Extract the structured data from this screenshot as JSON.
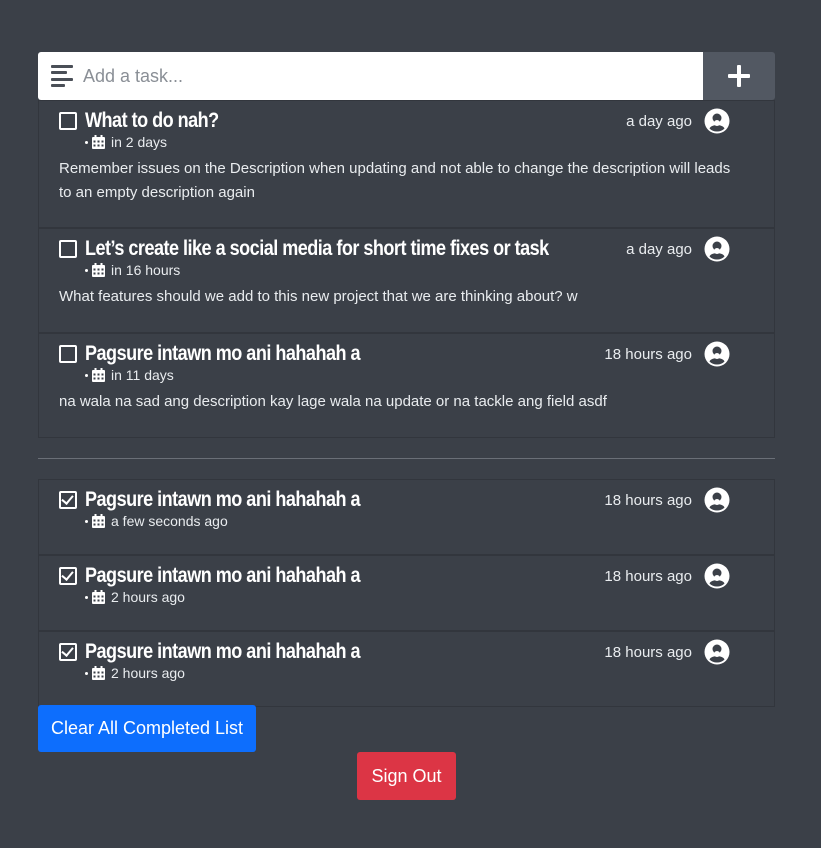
{
  "add_task": {
    "placeholder": "Add a task...",
    "button_icon": "plus-icon"
  },
  "pending_tasks": [
    {
      "title": "What to do nah?",
      "time_ago": "a day ago",
      "due": "in 2 days",
      "description": "Remember issues on the Description when updating and not able to change the description will leads to an empty description again",
      "completed": false
    },
    {
      "title": "Let’s create like a social media for short time fixes or task",
      "time_ago": "a day ago",
      "due": "in 16 hours",
      "description": "What features should we add to this new project that we are thinking about? w",
      "completed": false
    },
    {
      "title": "Pagsure intawn mo ani hahahah a",
      "time_ago": "18 hours ago",
      "due": "in 11 days",
      "description": "na wala na sad ang description kay lage wala na update or na tackle ang field asdf",
      "completed": false
    }
  ],
  "completed_tasks": [
    {
      "title": "Pagsure intawn mo ani hahahah a",
      "time_ago": "18 hours ago",
      "due": "a few seconds ago",
      "completed": true
    },
    {
      "title": "Pagsure intawn mo ani hahahah a",
      "time_ago": "18 hours ago",
      "due": "2 hours ago",
      "completed": true
    },
    {
      "title": "Pagsure intawn mo ani hahahah a",
      "time_ago": "18 hours ago",
      "due": "2 hours ago",
      "completed": true
    }
  ],
  "buttons": {
    "clear_completed": "Clear All Completed List",
    "sign_out": "Sign Out"
  },
  "colors": {
    "background": "#3b4048",
    "primary": "#0d6efd",
    "danger": "#dc3545",
    "add_button": "#525862"
  }
}
